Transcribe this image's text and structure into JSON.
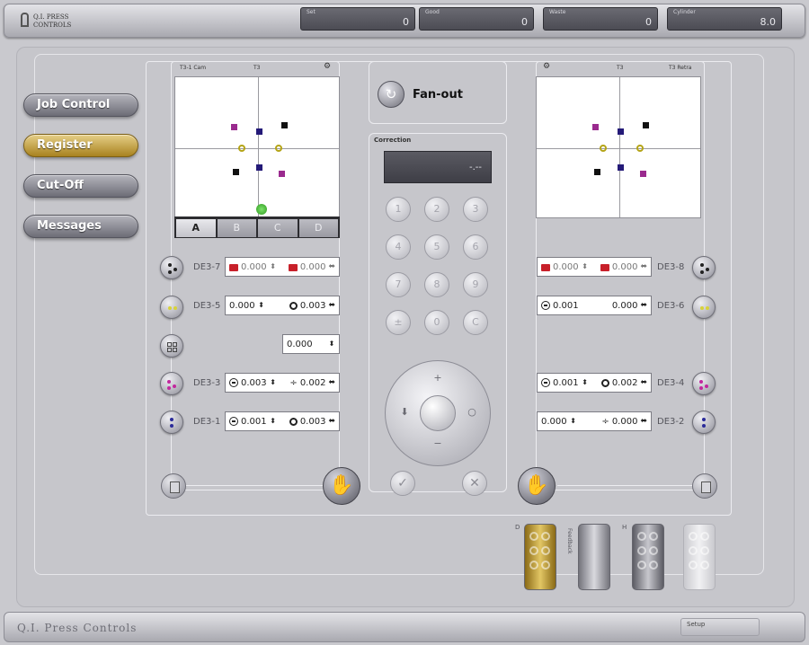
{
  "header": {
    "logo_line1": "Q.I. PRESS",
    "logo_line2": "CONTROLS",
    "counters": [
      {
        "label": "Set",
        "value": "0"
      },
      {
        "label": "Good",
        "value": "0"
      },
      {
        "label": "Waste",
        "value": "0"
      },
      {
        "label": "Cylinder",
        "value": "8.0"
      }
    ]
  },
  "nav": {
    "job_control": "Job Control",
    "register": "Register",
    "cut_off": "Cut-Off",
    "messages": "Messages"
  },
  "left_panel": {
    "head_left": "T3-1 Cam",
    "head_center": "T3",
    "tabs": [
      "A",
      "B",
      "C",
      "D"
    ],
    "rows": [
      {
        "label": "DE3-7",
        "v1": "0.000",
        "v2": "0.000"
      },
      {
        "label": "DE3-5",
        "v1": "0.000",
        "v2": "0.003"
      },
      {
        "label": "",
        "v1": "0.000",
        "v2": ""
      },
      {
        "label": "DE3-3",
        "v1": "0.003",
        "v2": "0.002"
      },
      {
        "label": "DE3-1",
        "v1": "0.001",
        "v2": "0.003"
      }
    ]
  },
  "right_panel": {
    "head_center": "T3",
    "head_right": "T3 Retra",
    "rows": [
      {
        "label": "DE3-8",
        "v1": "0.000",
        "v2": "0.000"
      },
      {
        "label": "DE3-6",
        "v1": "0.001",
        "v2": "0.000"
      },
      {
        "label": "DE3-4",
        "v1": "0.001",
        "v2": "0.002"
      },
      {
        "label": "DE3-2",
        "v1": "0.000",
        "v2": "0.000"
      }
    ]
  },
  "center": {
    "fan_out": "Fan-out",
    "correction": "Correction",
    "display_value": "-.--",
    "keys": [
      "1",
      "2",
      "3",
      "4",
      "5",
      "6",
      "7",
      "8",
      "9",
      "±",
      "0",
      "C"
    ]
  },
  "rollers": {
    "label_a": "D",
    "label_b": "H",
    "vertical": "Feedback"
  },
  "footer": {
    "brand": "Q.I. Press Controls",
    "setup": "Setup"
  },
  "colors": {
    "accent_active": "#c9a53c",
    "marker_navy": "#241a78",
    "marker_magenta": "#9a2a8e",
    "marker_yellow": "#b4a417"
  }
}
